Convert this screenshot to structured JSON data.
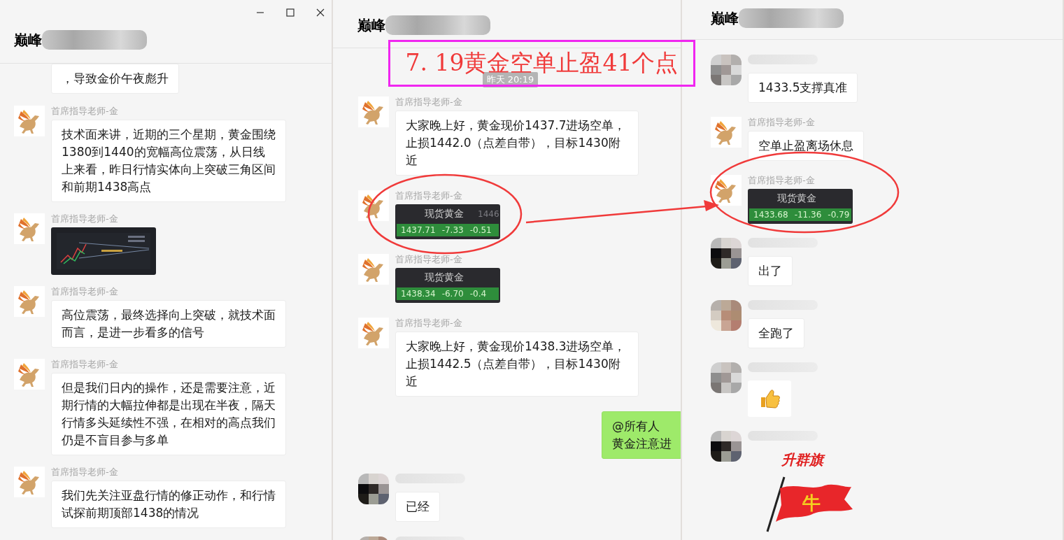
{
  "banner": {
    "text": "7. 19黄金空单止盈41个点"
  },
  "windows": [
    {
      "title": "巅峰",
      "window_controls": true,
      "messages": [
        {
          "kind": "text",
          "text": "，导致金价午夜彪升"
        },
        {
          "kind": "text",
          "avatar": {
            "kind": "phoenix"
          },
          "sender": "首席指导老师-金",
          "text": "技术面来讲，近期的三个星期，黄金围绕1380到1440的宽幅高位震荡，从日线上来看，昨日行情实体向上突破三角区间和前期1438高点"
        },
        {
          "kind": "image",
          "avatar": {
            "kind": "phoenix"
          },
          "sender": "首席指导老师-金"
        },
        {
          "kind": "text",
          "avatar": {
            "kind": "phoenix"
          },
          "sender": "首席指导老师-金",
          "text": "高位震荡，最终选择向上突破，就技术面而言，是进一步看多的信号"
        },
        {
          "kind": "text",
          "avatar": {
            "kind": "phoenix"
          },
          "sender": "首席指导老师-金",
          "text": "但是我们日内的操作，还是需要注意，近期行情的大幅拉伸都是出现在半夜，隔天行情多头延续性不强，在相对的高点我们仍是不盲目参与多单"
        },
        {
          "kind": "text",
          "avatar": {
            "kind": "phoenix"
          },
          "sender": "首席指导老师-金",
          "text": "我们先关注亚盘行情的修正动作，和行情试探前期顶部1438的情况"
        }
      ]
    },
    {
      "title": "巅峰",
      "window_controls": false,
      "timestamp": "昨天 20:19",
      "messages": [
        {
          "kind": "text",
          "avatar": {
            "kind": "phoenix"
          },
          "sender": "首席指导老师-金",
          "text": "大家晚上好，黄金现价1437.7进场空单，止损1442.0（点差自带），目标1430附近"
        },
        {
          "kind": "quote",
          "avatar": {
            "kind": "phoenix"
          },
          "sender": "首席指导老师-金",
          "name": "现货黄金",
          "extra": "1446",
          "price": "1437.71",
          "change": "-7.33",
          "percent": "-0.51"
        },
        {
          "kind": "quote",
          "avatar": {
            "kind": "phoenix"
          },
          "sender": "首席指导老师-金",
          "name": "现货黄金",
          "price": "1438.34",
          "change": "-6.70",
          "percent": "-0.4"
        },
        {
          "kind": "text",
          "avatar": {
            "kind": "phoenix"
          },
          "sender": "首席指导老师-金",
          "text": "大家晚上好，黄金现价1438.3进场空单，止损1442.5（点差自带），目标1430附近"
        },
        {
          "kind": "text",
          "outgoing": true,
          "mention": "@所有人",
          "text": "黄金注意进"
        },
        {
          "kind": "text",
          "avatar": {
            "kind": "blurred"
          },
          "text": "已经"
        },
        {
          "kind": "cut",
          "avatar": {
            "kind": "blurred"
          }
        }
      ]
    },
    {
      "title": "巅峰",
      "window_controls": false,
      "messages": [
        {
          "kind": "text",
          "avatar": {
            "kind": "blurred"
          },
          "text": "1433.5支撑真准"
        },
        {
          "kind": "text",
          "avatar": {
            "kind": "phoenix"
          },
          "sender": "首席指导老师-金",
          "text": "空单止盈离场休息"
        },
        {
          "kind": "quote",
          "avatar": {
            "kind": "phoenix"
          },
          "sender": "首席指导老师-金",
          "name": "现货黄金",
          "price": "1433.68",
          "change": "-11.36",
          "percent": "-0.79"
        },
        {
          "kind": "text",
          "avatar": {
            "kind": "blurred"
          },
          "text": "出了"
        },
        {
          "kind": "text",
          "avatar": {
            "kind": "blurred"
          },
          "text": "全跑了"
        },
        {
          "kind": "sticker",
          "avatar": {
            "kind": "blurred"
          }
        },
        {
          "kind": "flag",
          "avatar": {
            "kind": "blurred"
          },
          "caption": "升群旗",
          "symbol": "牛"
        }
      ]
    }
  ]
}
